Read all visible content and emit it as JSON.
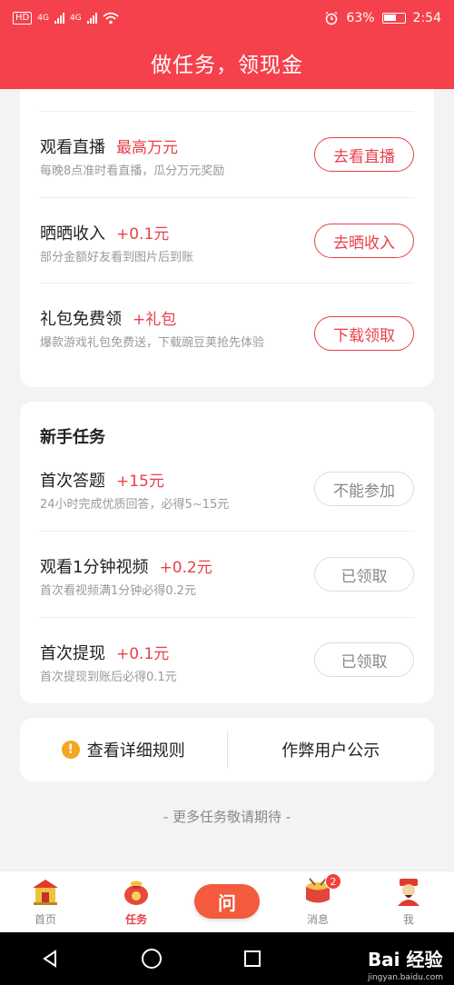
{
  "status_bar": {
    "hd_label": "HD",
    "net1": "4G",
    "net2": "4G",
    "battery_percent": "63%",
    "battery_level": 0.63,
    "time": "2:54",
    "icons": [
      "signal-icon",
      "wifi-icon",
      "alarm-icon",
      "battery-icon"
    ]
  },
  "header": {
    "title": "做任务，领现金"
  },
  "daily_tasks": [
    {
      "title": "观看直播",
      "reward": "最高万元",
      "desc": "每晚8点准时看直播，瓜分万元奖励",
      "button": "去看直播",
      "enabled": true
    },
    {
      "title": "晒晒收入",
      "reward": "+0.1元",
      "desc": "部分金额好友看到图片后到账",
      "button": "去晒收入",
      "enabled": true
    },
    {
      "title": "礼包免费领",
      "reward": "+礼包",
      "desc": "爆款游戏礼包免费送，下载豌豆荚抢先体验",
      "button": "下载领取",
      "enabled": true
    }
  ],
  "newbie": {
    "section_title": "新手任务",
    "tasks": [
      {
        "title": "首次答题",
        "reward": "+15元",
        "desc": "24小时完成优质回答，必得5~15元",
        "button": "不能参加",
        "enabled": false
      },
      {
        "title": "观看1分钟视频",
        "reward": "+0.2元",
        "desc": "首次看视频满1分钟必得0.2元",
        "button": "已领取",
        "enabled": false
      },
      {
        "title": "首次提现",
        "reward": "+0.1元",
        "desc": "首次提现到账后必得0.1元",
        "button": "已领取",
        "enabled": false
      }
    ]
  },
  "links": {
    "rules": "查看详细规则",
    "cheaters": "作弊用户公示"
  },
  "more_text": "- 更多任务敬请期待 -",
  "tabbar": {
    "tabs": [
      {
        "label": "首页",
        "icon": "home-temple-icon",
        "active": false
      },
      {
        "label": "任务",
        "icon": "money-bag-icon",
        "active": true
      },
      {
        "label": "问",
        "icon": "ask-icon",
        "active": false
      },
      {
        "label": "消息",
        "icon": "drum-icon",
        "active": false,
        "badge": "2"
      },
      {
        "label": "我",
        "icon": "fortune-god-avatar-icon",
        "active": false
      }
    ]
  },
  "nav": {
    "icons": [
      "back-icon",
      "home-circle-icon",
      "recents-square-icon"
    ]
  },
  "watermark": {
    "brand": "Bai 经验",
    "url": "jingyan.baidu.com"
  },
  "colors": {
    "primary": "#f5414c",
    "reward": "#e8404a",
    "background": "#f3f3f3"
  }
}
